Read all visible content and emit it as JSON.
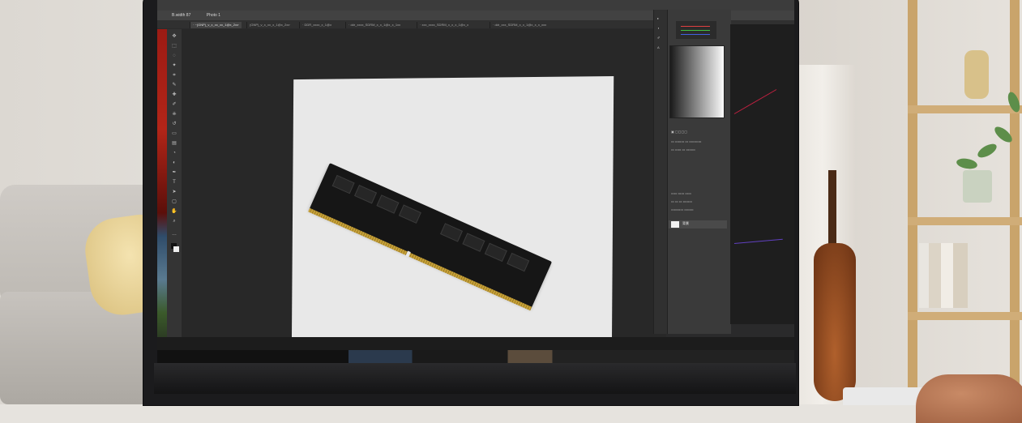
{
  "photoshop": {
    "options_bar": [
      "B.width 87",
      "Photo 1"
    ],
    "tabs": [
      "· ~(GNP)_v_x_xx_xx_1@x_2xx·",
      "(GNP)_v_x_xx_x_1@x_2xx·",
      "· DDR_xxxx_x_1@x",
      "· ddr_xxxx_SDRM_x_x_1@x_x_1xx",
      "· xxx_xxxx_SDRM_x_x_x_1@x_x",
      "· ddr_xxx_SDRM_x_x_1@x_x_x_xxx"
    ],
    "layer_name": "背景"
  },
  "colors": {
    "screen_bg": "#2a2a2b",
    "canvas_bg": "#e8e8e8",
    "ram_gold": "#c7a23a"
  }
}
